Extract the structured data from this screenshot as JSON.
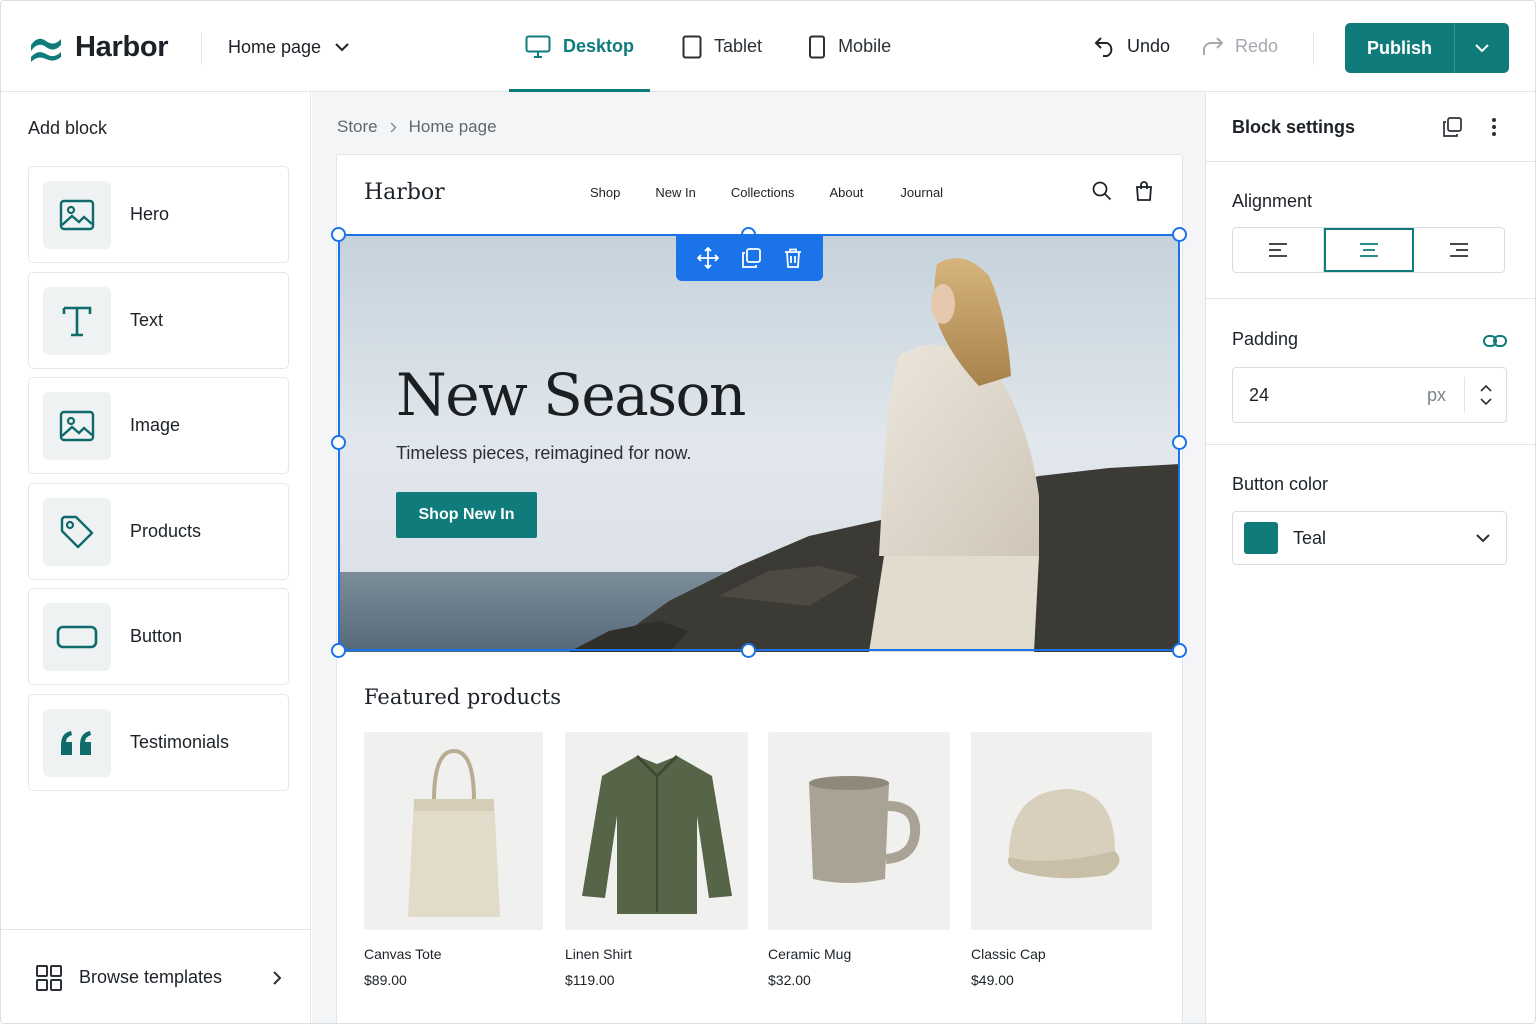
{
  "app": {
    "name": "Harbor"
  },
  "topbar": {
    "page_select": "Home page",
    "devices": [
      {
        "label": "Desktop",
        "icon": "monitor-icon",
        "active": true
      },
      {
        "label": "Tablet",
        "icon": "tablet-icon",
        "active": false
      },
      {
        "label": "Mobile",
        "icon": "mobile-icon",
        "active": false
      }
    ],
    "undo_label": "Undo",
    "redo_label": "Redo",
    "publish_label": "Publish"
  },
  "sidebar": {
    "title": "Add block",
    "blocks": [
      {
        "label": "Hero",
        "icon": "image-icon"
      },
      {
        "label": "Text",
        "icon": "text-icon"
      },
      {
        "label": "Image",
        "icon": "image-icon"
      },
      {
        "label": "Products",
        "icon": "tag-icon"
      },
      {
        "label": "Button",
        "icon": "button-icon"
      },
      {
        "label": "Testimonials",
        "icon": "quote-icon"
      }
    ],
    "browse_label": "Browse templates"
  },
  "breadcrumb": [
    "Store",
    "Home page"
  ],
  "preview": {
    "brand": "Harbor",
    "nav_links": [
      "Shop",
      "New In",
      "Collections",
      "About",
      "Journal"
    ],
    "hero": {
      "title": "New Season",
      "subtitle": "Timeless pieces, reimagined for now.",
      "button": "Shop New In"
    },
    "featured_title": "Featured products",
    "products": [
      {
        "name": "Canvas Tote",
        "price": "$89.00"
      },
      {
        "name": "Linen Shirt",
        "price": "$119.00"
      },
      {
        "name": "Ceramic Mug",
        "price": "$32.00"
      },
      {
        "name": "Classic Cap",
        "price": "$49.00"
      }
    ]
  },
  "settings": {
    "title": "Block settings",
    "alignment_label": "Alignment",
    "alignment_selected": "center",
    "padding_label": "Padding",
    "padding_value": "24",
    "padding_unit": "px",
    "button_color_label": "Button color",
    "button_color_name": "Teal",
    "button_color_hex": "#0f7b7b"
  },
  "colors": {
    "accent": "#0f7b7b",
    "selection": "#1a73e8"
  }
}
